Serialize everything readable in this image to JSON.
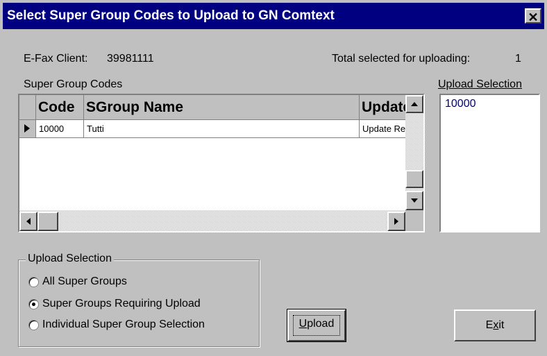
{
  "window": {
    "title": "Select Super Group Codes to Upload to GN Comtext",
    "close_glyph": "✕"
  },
  "info": {
    "client_label": "E-Fax Client:",
    "client_value": "39981111",
    "total_label": "Total selected for uploading:",
    "total_value": "1"
  },
  "grid": {
    "label": "Super Group Codes",
    "columns": [
      "Code",
      "SGroup Name",
      "Update"
    ],
    "rows": [
      {
        "code": "10000",
        "name": "Tutti",
        "update": "Update Re"
      }
    ]
  },
  "upload_list": {
    "label": "Upload Selection",
    "items": [
      "10000"
    ]
  },
  "options": {
    "title": "Upload Selection",
    "choices": [
      {
        "label": "All Super Groups",
        "selected": false
      },
      {
        "label": "Super Groups Requiring Upload",
        "selected": true
      },
      {
        "label": "Individual Super Group Selection",
        "selected": false
      }
    ]
  },
  "buttons": {
    "upload_pre": "",
    "upload_key": "U",
    "upload_post": "pload",
    "exit_pre": "E",
    "exit_key": "x",
    "exit_post": "it"
  },
  "icons": {
    "row_pointer": "triangle-right-icon",
    "scroll_up": "arrow-up-icon",
    "scroll_down": "arrow-down-icon",
    "scroll_left": "arrow-left-icon",
    "scroll_right": "arrow-right-icon"
  }
}
